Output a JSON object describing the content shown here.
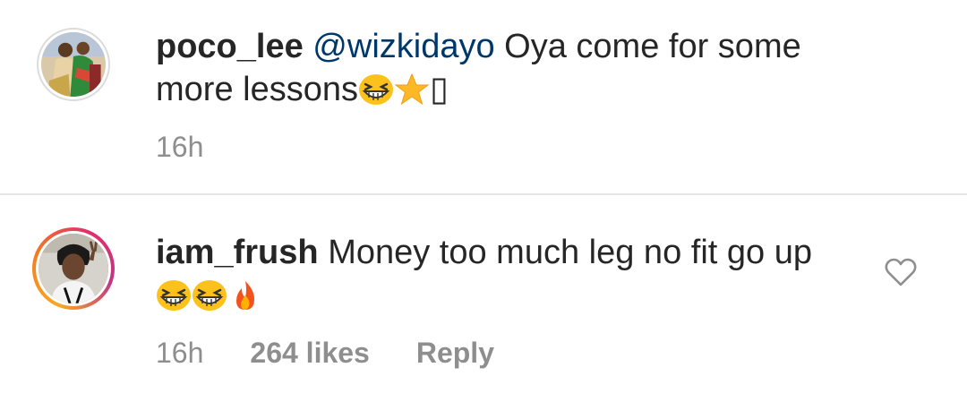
{
  "comments": [
    {
      "username": "poco_lee",
      "mention": "@wizkidayo",
      "text": "Oya come for some more lessons",
      "trailing_glyph": "▯",
      "time": "16h"
    },
    {
      "username": "iam_frush",
      "text": "Money too much leg no fit go up",
      "time": "16h",
      "likes": "264 likes",
      "reply_label": "Reply"
    }
  ],
  "icons": {
    "like": "heart-outline-icon",
    "emoji_laugh": "grinning-squinting-face-icon",
    "emoji_star": "star-icon",
    "emoji_fire": "fire-icon"
  },
  "colors": {
    "mention": "#00376b",
    "meta": "#8e8e8e",
    "text": "#262626",
    "divider": "#e6e6e6"
  }
}
